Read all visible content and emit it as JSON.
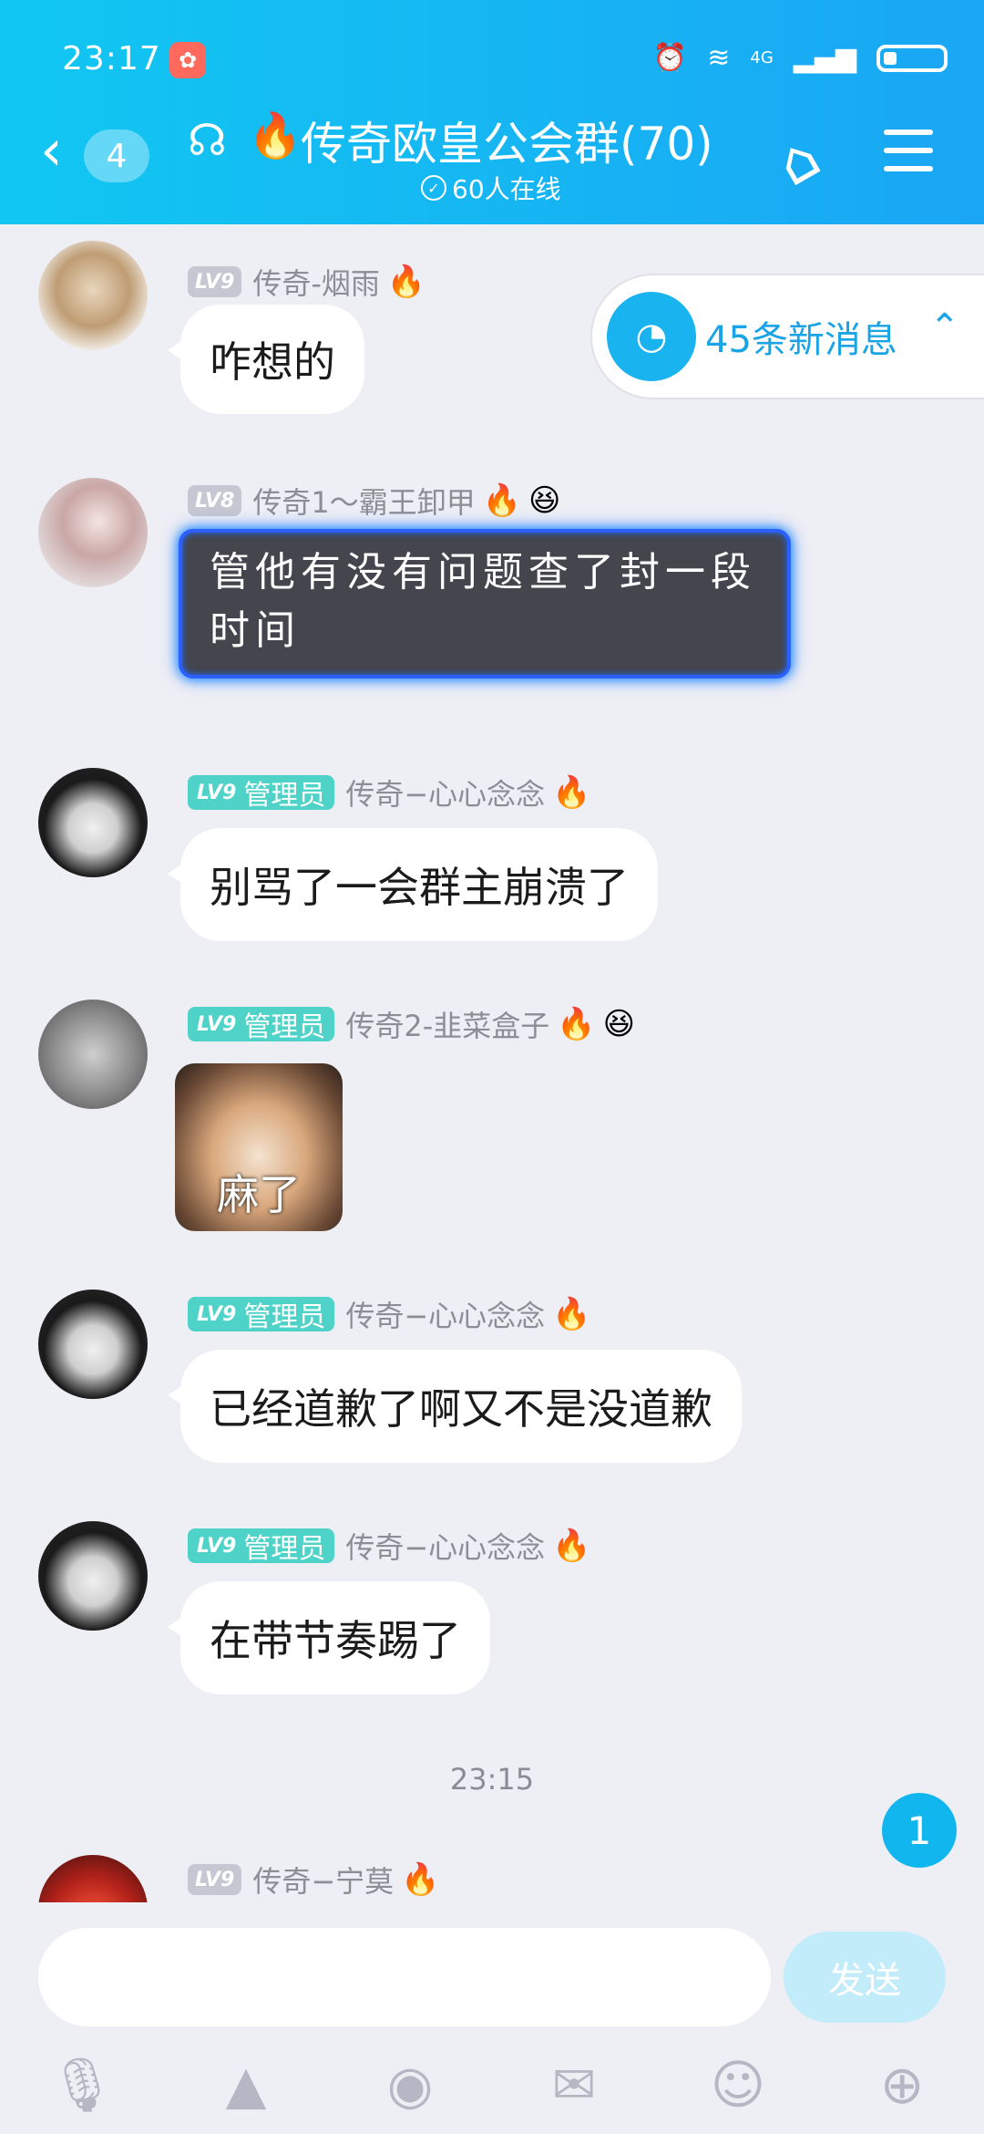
{
  "status_bar": {
    "time": "23:17",
    "network": "4G"
  },
  "header": {
    "back_count": "4",
    "title": "传奇欧皇公会群(70)",
    "online": "60人在线"
  },
  "new_messages_pill": "45条新消息",
  "messages": [
    {
      "level": "LV9",
      "role": "",
      "nickname": "传奇-烟雨",
      "text": "咋想的"
    },
    {
      "level": "LV8",
      "role": "",
      "nickname": "传奇1～霸王卸甲",
      "text": "管他有没有问题查了封一段时间"
    },
    {
      "level": "LV9",
      "role": "管理员",
      "nickname": "传奇−心心念念",
      "text": "别骂了一会群主崩溃了"
    },
    {
      "level": "LV9",
      "role": "管理员",
      "nickname": "传奇2-韭菜盒子",
      "sticker_caption": "麻了"
    },
    {
      "level": "LV9",
      "role": "管理员",
      "nickname": "传奇−心心念念",
      "text": "已经道歉了啊又不是没道歉"
    },
    {
      "level": "LV9",
      "role": "管理员",
      "nickname": "传奇−心心念念",
      "text": "在带节奏踢了"
    },
    {
      "level": "LV9",
      "role": "",
      "nickname": "传奇−宁莫",
      "text": ""
    }
  ],
  "timestamp": "23:15",
  "unread_badge": "1",
  "composer": {
    "send_label": "发送"
  },
  "icons": [
    "back-icon",
    "ear-icon",
    "fire-icon",
    "tag-icon",
    "menu-icon",
    "chat-bubble-icon",
    "chevron-up-icon",
    "microphone-icon",
    "image-icon",
    "camera-icon",
    "red-packet-icon",
    "emoji-icon",
    "plus-icon"
  ],
  "colors": {
    "header": "#13b9f3",
    "accent": "#1aa4e6",
    "admin_badge": "#4fd3c8"
  }
}
